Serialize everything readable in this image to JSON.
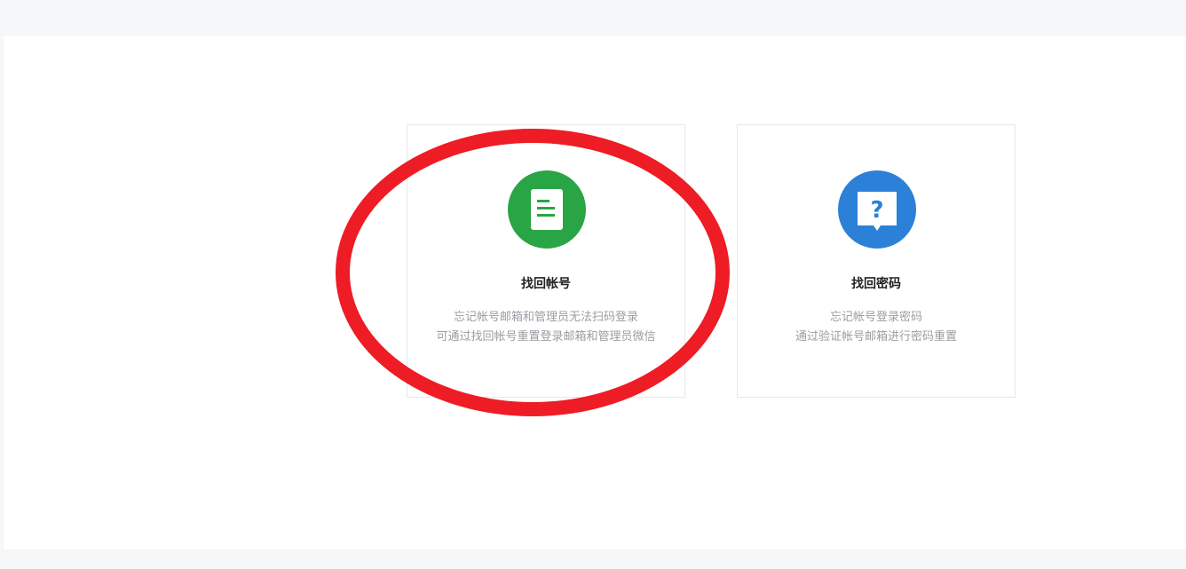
{
  "cards": [
    {
      "title": "找回帐号",
      "desc_line1": "忘记帐号邮箱和管理员无法扫码登录",
      "desc_line2": "可通过找回帐号重置登录邮箱和管理员微信",
      "icon": "document-icon",
      "color": "#2aa545"
    },
    {
      "title": "找回密码",
      "desc_line1": "忘记帐号登录密码",
      "desc_line2": "通过验证帐号邮箱进行密码重置",
      "icon": "question-bubble-icon",
      "color": "#2b80d8"
    }
  ],
  "annotation": {
    "color": "#ee1c25"
  }
}
